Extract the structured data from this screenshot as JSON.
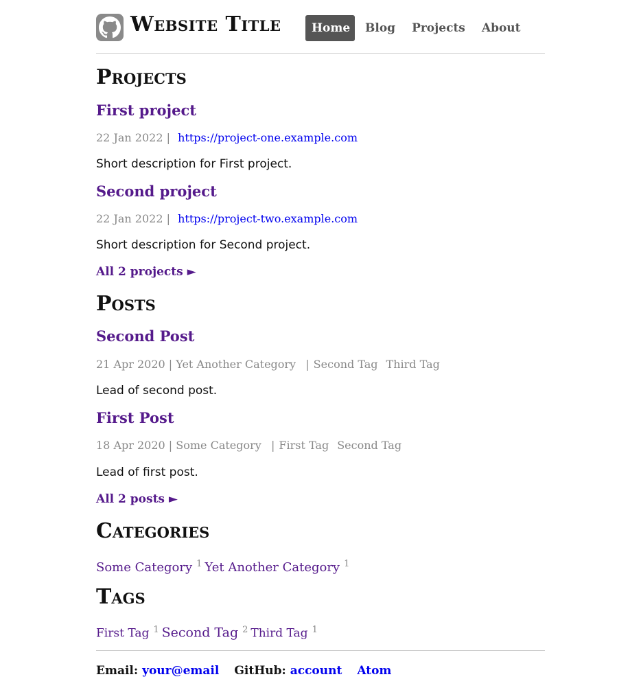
{
  "header": {
    "site_title": "Website Title",
    "logo_icon": "github-icon",
    "nav": [
      "Home",
      "Blog",
      "Projects",
      "About"
    ]
  },
  "projects": {
    "heading": "Projects",
    "items": [
      {
        "title": "First project",
        "date": "22 Jan 2022",
        "url": "https://project-one.example.com",
        "description": "Short description for First project."
      },
      {
        "title": "Second project",
        "date": "22 Jan 2022",
        "url": "https://project-two.example.com",
        "description": "Short description for Second project."
      }
    ],
    "more": "All 2 projects ►"
  },
  "posts": {
    "heading": "Posts",
    "items": [
      {
        "title": "Second Post",
        "date": "21 Apr 2020",
        "category": "Yet Another Category",
        "tags": [
          "Second Tag",
          "Third Tag"
        ],
        "lead": "Lead of second post."
      },
      {
        "title": "First Post",
        "date": "18 Apr 2020",
        "category": "Some Category",
        "tags": [
          "First Tag",
          "Second Tag"
        ],
        "lead": "Lead of first post."
      }
    ],
    "more": "All 2 posts ►"
  },
  "categories": {
    "heading": "Categories",
    "items": [
      {
        "name": "Some Category",
        "count": "1"
      },
      {
        "name": "Yet Another Category",
        "count": "1"
      }
    ]
  },
  "tags": {
    "heading": "Tags",
    "items": [
      {
        "name": "First Tag",
        "count": "1"
      },
      {
        "name": "Second Tag",
        "count": "2"
      },
      {
        "name": "Third Tag",
        "count": "1"
      }
    ]
  },
  "footer": {
    "email_label": "Email:",
    "email_value": "your@email",
    "github_label": "GitHub:",
    "github_value": "account",
    "atom": "Atom"
  }
}
